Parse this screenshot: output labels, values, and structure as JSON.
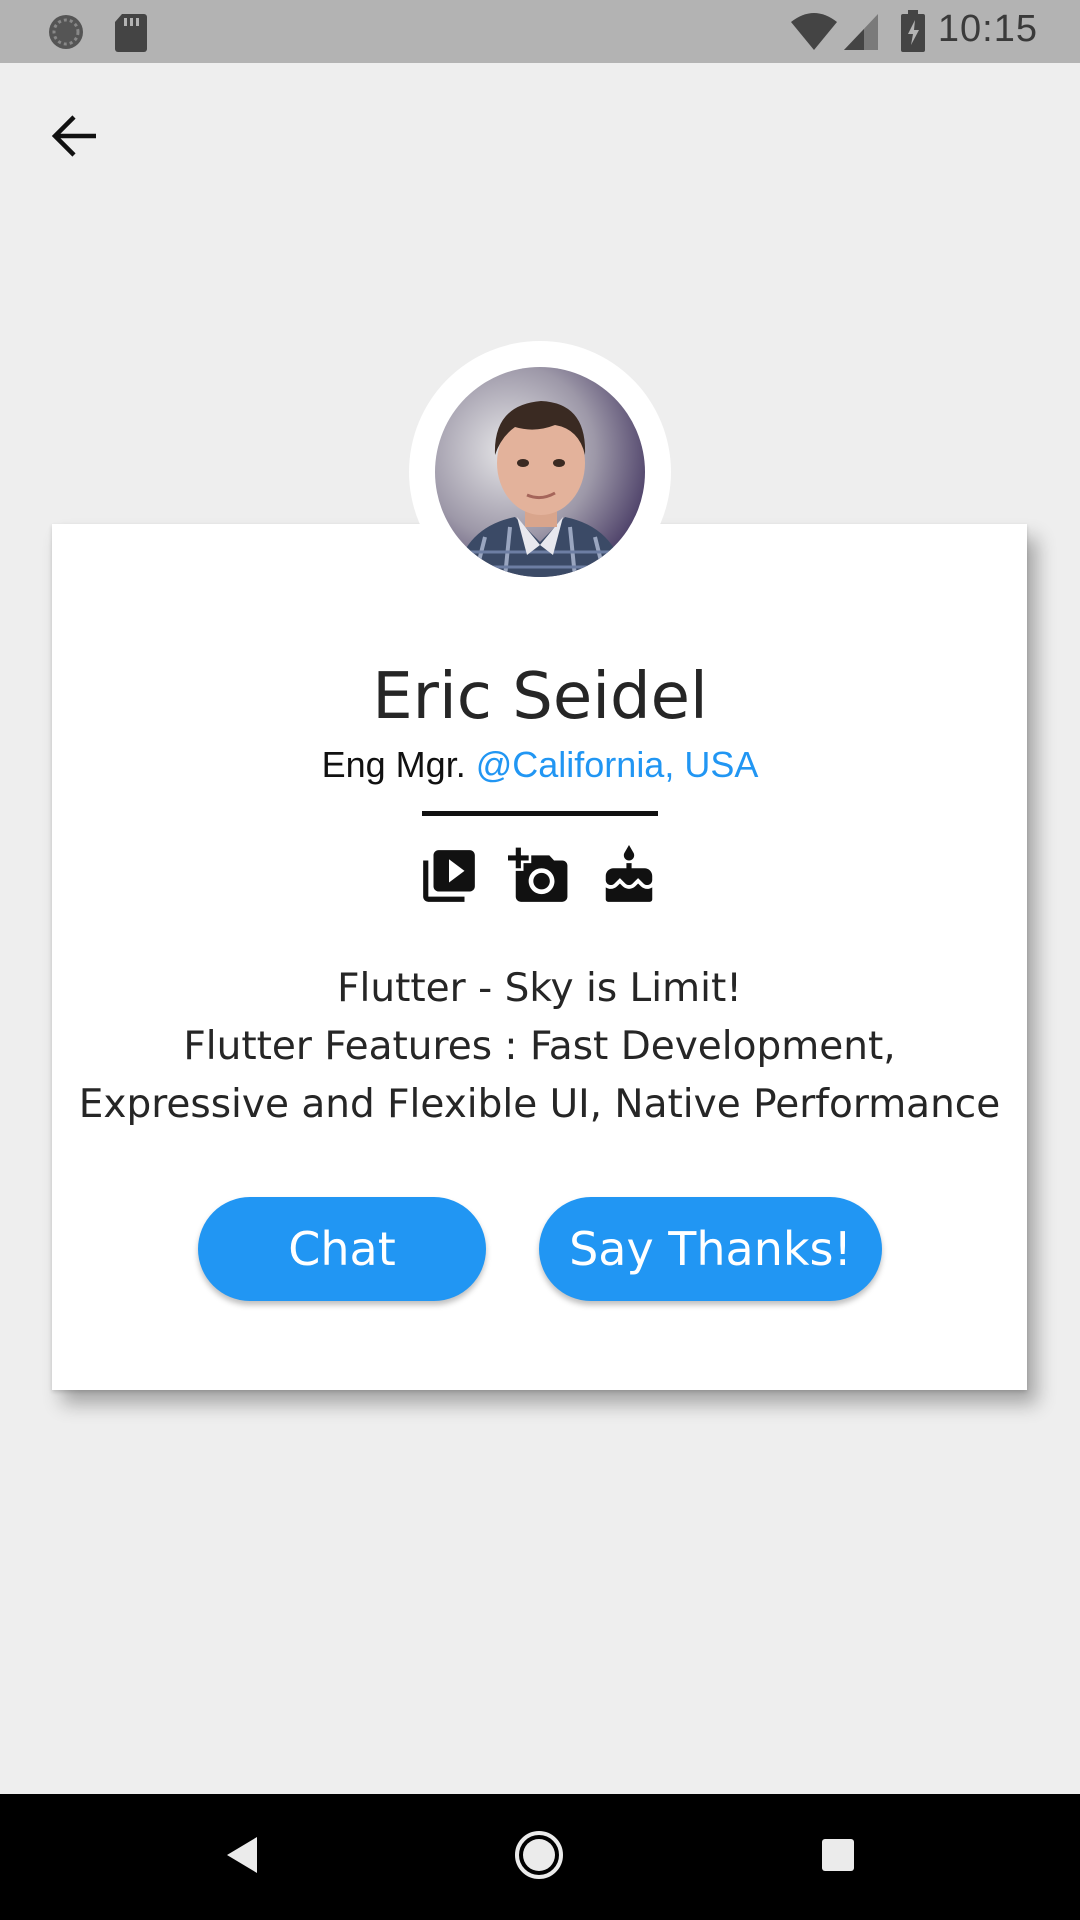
{
  "status_bar": {
    "time": "10:15",
    "left_icons": [
      "sync-icon",
      "sd-card-icon"
    ],
    "right_icons": [
      "wifi-icon",
      "cell-signal-icon",
      "battery-charging-icon"
    ]
  },
  "app_bar": {
    "back_icon": "arrow-back-icon"
  },
  "profile": {
    "name": "Eric Seidel",
    "role": "Eng Mgr.",
    "location": "@California, USA",
    "icons": [
      "video-library-icon",
      "add-a-photo-icon",
      "cake-icon"
    ],
    "description_lines": [
      "Flutter - Sky is Limit!",
      "Flutter Features : Fast Development,",
      "Expressive and Flexible UI, Native Performance"
    ],
    "accent_color": "#2196f3"
  },
  "actions": {
    "chat_label": "Chat",
    "thanks_label": "Say Thanks!"
  },
  "nav_bar": {
    "icons": [
      "back-triangle-icon",
      "home-circle-icon",
      "recents-square-icon"
    ]
  }
}
